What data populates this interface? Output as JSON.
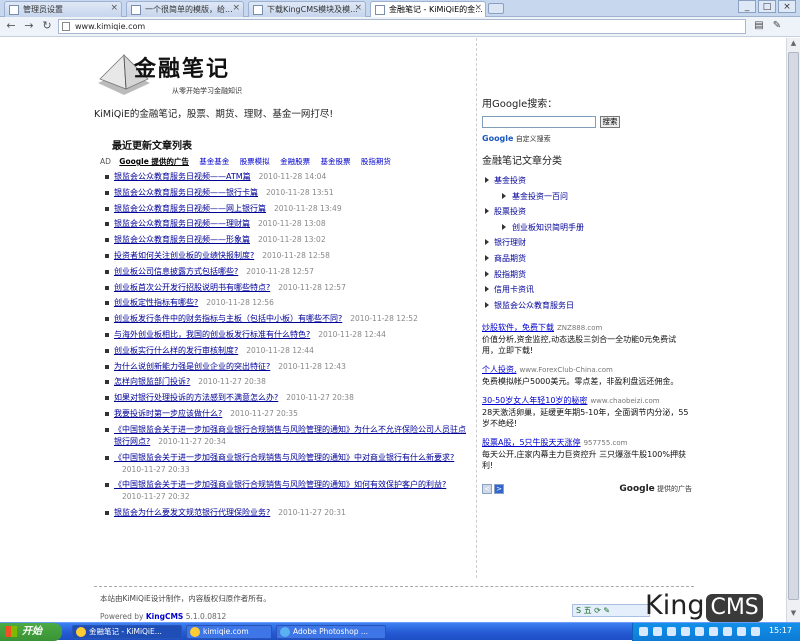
{
  "tabs": [
    {
      "label": "管理员设置"
    },
    {
      "label": "一个很简单的模版，给..."
    },
    {
      "label": "下载KingCMS模块及模..."
    },
    {
      "label": "金融笔记 - KiMiQiE的金..."
    }
  ],
  "address": {
    "url": "www.kimiqie.com"
  },
  "site": {
    "logo_text": "金融笔记",
    "logo_sub": "从零开始学习金融知识",
    "tagline": "KiMiQiE的金融笔记，股票、期货、理财、基金一网打尽!"
  },
  "latest": {
    "title": "最近更新文章列表",
    "ad_label": "AD",
    "ad_provider": "Google 提供的广告",
    "ad_links": [
      "基金基金",
      "股票模拟",
      "金融股票",
      "基金股票",
      "股指期货"
    ],
    "articles": [
      {
        "title": "银监会公众教育服务日视频——ATM篇",
        "date": "2010-11-28 14:04"
      },
      {
        "title": "银监会公众教育服务日视频——银行卡篇",
        "date": "2010-11-28 13:51"
      },
      {
        "title": "银监会公众教育服务日视频——网上银行篇",
        "date": "2010-11-28 13:49"
      },
      {
        "title": "银监会公众教育服务日视频——理财篇",
        "date": "2010-11-28 13:08"
      },
      {
        "title": "银监会公众教育服务日视频——形象篇",
        "date": "2010-11-28 13:02"
      },
      {
        "title": "投资者如何关注创业板的业绩快报制度?",
        "date": "2010-11-28 12:58"
      },
      {
        "title": "创业板公司信息披露方式包括哪些?",
        "date": "2010-11-28 12:57"
      },
      {
        "title": "创业板首次公开发行招股说明书有哪些特点?",
        "date": "2010-11-28 12:57"
      },
      {
        "title": "创业板定性指标有哪些?",
        "date": "2010-11-28 12:56"
      },
      {
        "title": "创业板发行条件中的财务指标与主板（包括中小板）有哪些不同?",
        "date": "2010-11-28 12:52"
      },
      {
        "title": "与海外创业板相比，我国的创业板发行标准有什么特色?",
        "date": "2010-11-28 12:44"
      },
      {
        "title": "创业板实行什么样的发行审核制度?",
        "date": "2010-11-28 12:44"
      },
      {
        "title": "为什么说创新能力强是创业企业的突出特征?",
        "date": "2010-11-28 12:43"
      },
      {
        "title": "怎样向银监部门投诉?",
        "date": "2010-11-27 20:38"
      },
      {
        "title": "如果对银行处理投诉的方法感到不满意怎么办?",
        "date": "2010-11-27 20:38"
      },
      {
        "title": "我要投诉时第一步应该做什么?",
        "date": "2010-11-27 20:35"
      },
      {
        "title": "《中国银监会关于进一步加强商业银行合规销售与风险管理的通知》为什么不允许保险公司人员驻点银行网点?",
        "date": "2010-11-27 20:34"
      },
      {
        "title": "《中国银监会关于进一步加强商业银行合规销售与风险管理的通知》中对商业银行有什么新要求?",
        "date": "2010-11-27 20:33"
      },
      {
        "title": "《中国银监会关于进一步加强商业银行合规销售与风险管理的通知》如何有效保护客户的利益?",
        "date": "2010-11-27 20:32"
      },
      {
        "title": "银监会为什么要发文规范银行代理保险业务?",
        "date": "2010-11-27 20:31"
      }
    ]
  },
  "sidebar": {
    "search_title": "用Google搜索：",
    "search_button": "搜索",
    "google_custom": "Google",
    "google_custom_suffix": "自定义搜索",
    "categories_title": "金融笔记文章分类",
    "categories": [
      {
        "label": "基金投资",
        "sub": false
      },
      {
        "label": "基金投资一百问",
        "sub": true
      },
      {
        "label": "股票投资",
        "sub": false
      },
      {
        "label": "创业板知识简明手册",
        "sub": true
      },
      {
        "label": "银行理财",
        "sub": false
      },
      {
        "label": "商品期货",
        "sub": false
      },
      {
        "label": "股指期货",
        "sub": false
      },
      {
        "label": "信用卡资讯",
        "sub": false
      },
      {
        "label": "银监会公众教育服务日",
        "sub": false
      }
    ]
  },
  "ads": [
    {
      "headline": "炒股软件，免费下载",
      "url": "ZNZ888.com",
      "body": "价值分析,资金监控,动态选股三剑合一全功能0元免费试用，立即下载!"
    },
    {
      "headline": "个人投资,",
      "url": "www.ForexClub-China.com",
      "body": "免费模拟帐户5000美元。零点差，非盈利盘远还佣金。"
    },
    {
      "headline": "30-50岁女人年轻10岁的秘密",
      "url": "www.chaobeizi.com",
      "body": "28天激活卵巢，延缓更年期5-10年，全面调节内分泌，55岁不绝经!"
    },
    {
      "headline": "股票A股，5只牛股天天涨停",
      "url": "957755.com",
      "body": "每天公开,庄家内幕主力巨资控升 三只爆涨牛股100%押获利!"
    }
  ],
  "ads_footer": {
    "prev": "<",
    "next": ">",
    "provider_brand": "Google",
    "provider_text": "提供的广告"
  },
  "footer": {
    "copyright": "本站由KiMiQiE设计制作，内容版权归原作者所有。",
    "powered_prefix": "Powered by",
    "powered_link": "KingCMS",
    "version": "5.1.0.0812"
  },
  "watermark": {
    "king": "King",
    "cms": "CMS"
  },
  "ime": {
    "label": "五"
  },
  "taskbar": {
    "start": "开始",
    "tasks": [
      {
        "label": "金融笔记 - KiMiQiE..."
      },
      {
        "label": "kimiqie.com"
      },
      {
        "label": "Adobe Photoshop ..."
      }
    ],
    "clock": "15:17"
  }
}
